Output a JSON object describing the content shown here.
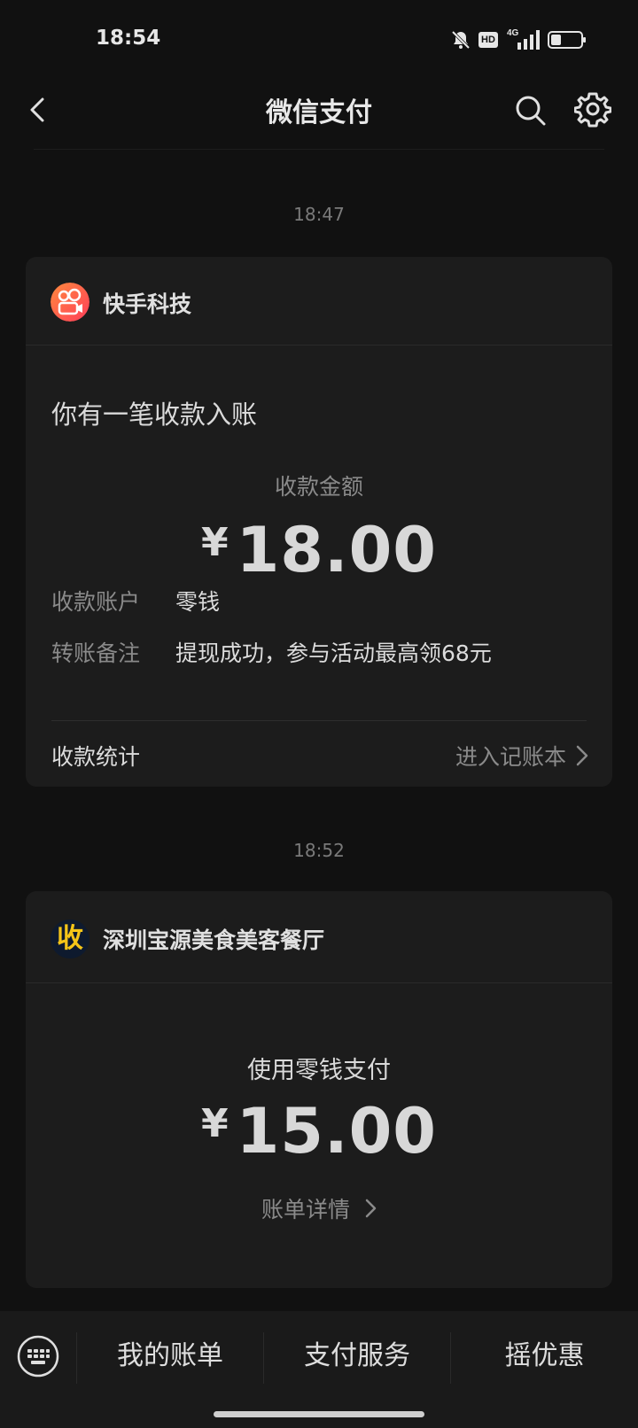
{
  "status_bar": {
    "time": "18:54",
    "hd_label": "HD",
    "network_label": "4G",
    "battery_level": 0.35
  },
  "nav": {
    "title": "微信支付",
    "back_icon": "chevron-left-icon",
    "search_icon": "search-icon",
    "settings_icon": "gear-icon"
  },
  "messages": [
    {
      "time": "18:47",
      "merchant": "快手科技",
      "notice": "你有一笔收款入账",
      "amount_label": "收款金额",
      "currency": "¥",
      "amount": "18.00",
      "rows": [
        {
          "key": "收款账户",
          "value": "零钱"
        },
        {
          "key": "转账备注",
          "value": "提现成功，参与活动最高领68元"
        }
      ],
      "stats_label": "收款统计",
      "stats_link": "进入记账本"
    },
    {
      "time": "18:52",
      "merchant": "深圳宝源美食美客餐厅",
      "merchant_logo_text": "收",
      "pay_label": "使用零钱支付",
      "currency": "¥",
      "amount": "15.00",
      "detail_link": "账单详情"
    }
  ],
  "bottom_bar": {
    "tabs": [
      "我的账单",
      "支付服务",
      "摇优惠"
    ],
    "keyboard_icon": "keyboard-icon"
  },
  "colors": {
    "background": "#111111",
    "card": "#1c1c1c",
    "kuaishou_logo": "#ff5a3c",
    "shou_logo_text": "#f5c518"
  }
}
